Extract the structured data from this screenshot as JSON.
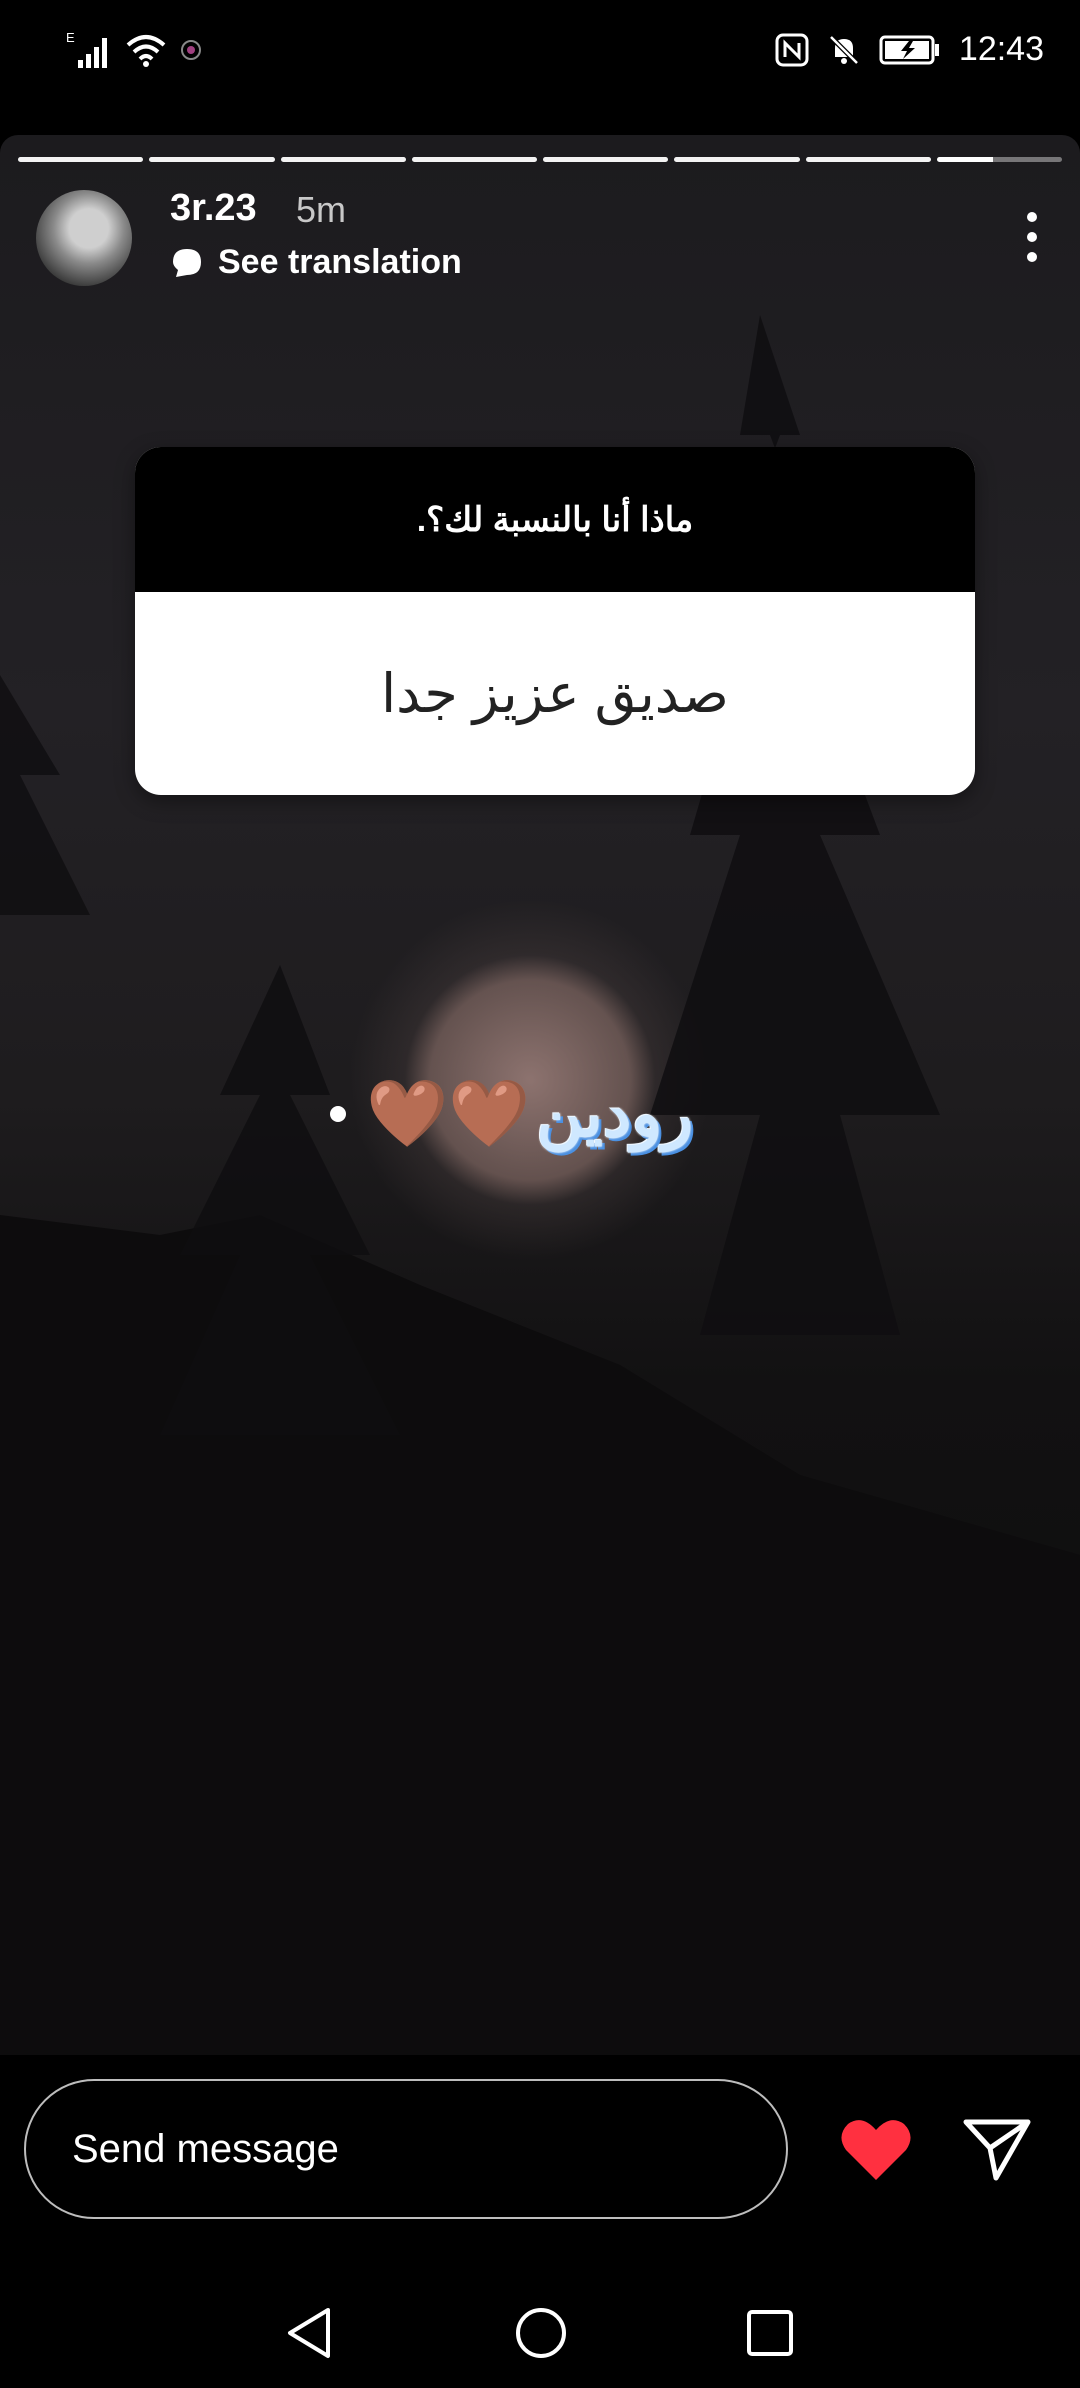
{
  "status_bar": {
    "time": "12:43",
    "network_label": "E",
    "icons": [
      "signal-icon",
      "wifi-icon",
      "record-icon",
      "nfc-icon",
      "mute-bell-icon",
      "battery-charging-icon"
    ]
  },
  "story": {
    "segments_total": 8,
    "current_segment_progress": 0.45,
    "user": {
      "username": "3r.23",
      "posted_ago": "5m"
    },
    "translate_label": "See translation",
    "question_sticker": {
      "question": "ماذا أنا بالنسبة لك؟.",
      "answer": "صديق عزيز جدا"
    },
    "text_sticker": {
      "text": "رودين",
      "emoji": "🤎🤎"
    }
  },
  "bottom_bar": {
    "message_placeholder": "Send message",
    "heart_color": "#ff3040"
  },
  "nav_icons": [
    "back-icon",
    "home-icon",
    "recents-icon"
  ]
}
